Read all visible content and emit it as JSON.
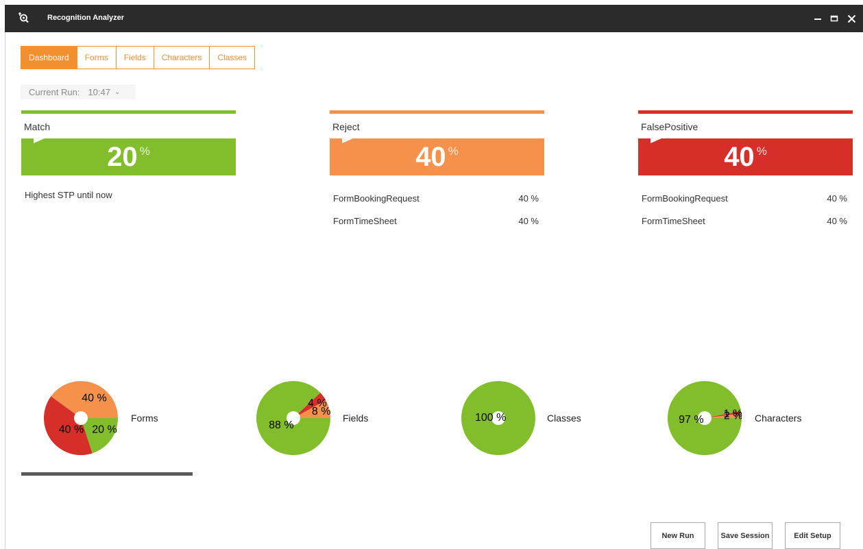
{
  "window": {
    "title": "Recognition Analyzer"
  },
  "tabs": [
    "Dashboard",
    "Forms",
    "Fields",
    "Characters",
    "Classes"
  ],
  "current_run": {
    "label": "Current Run:",
    "value": "10:47"
  },
  "cards": {
    "match": {
      "title": "Match",
      "value": "20",
      "unit": "%",
      "color": "#82be2c",
      "note": "Highest STP until now"
    },
    "reject": {
      "title": "Reject",
      "value": "40",
      "unit": "%",
      "color": "#f5914a",
      "rows": [
        {
          "name": "FormBookingRequest",
          "value": "40 %"
        },
        {
          "name": "FormTimeSheet",
          "value": "40 %"
        }
      ]
    },
    "falsepositive": {
      "title": "FalsePositive",
      "value": "40",
      "unit": "%",
      "color": "#d62e28",
      "rows": [
        {
          "name": "FormBookingRequest",
          "value": "40 %"
        },
        {
          "name": "FormTimeSheet",
          "value": "40 %"
        }
      ]
    }
  },
  "colors": {
    "match": "#82be2c",
    "reject": "#f5914a",
    "falsepositive": "#d62e28",
    "accent": "#f28f2e"
  },
  "charts": {
    "forms": {
      "label": "Forms",
      "slices": [
        {
          "name": "Match",
          "value": 20,
          "label": "20 %"
        },
        {
          "name": "Reject",
          "value": 40,
          "label": "40 %"
        },
        {
          "name": "FalsePositive",
          "value": 40,
          "label": "40 %"
        }
      ]
    },
    "fields": {
      "label": "Fields",
      "slices": [
        {
          "name": "Match",
          "value": 88,
          "label": "88 %"
        },
        {
          "name": "Reject",
          "value": 8,
          "label": "8 %"
        },
        {
          "name": "FalsePositive",
          "value": 4,
          "label": "4 %"
        }
      ]
    },
    "classes": {
      "label": "Classes",
      "slices": [
        {
          "name": "Match",
          "value": 100,
          "label": "100 %"
        }
      ]
    },
    "characters": {
      "label": "Characters",
      "slices": [
        {
          "name": "Match",
          "value": 97,
          "label": "97 %"
        },
        {
          "name": "Reject",
          "value": 2,
          "label": "2 %"
        },
        {
          "name": "FalsePositive",
          "value": 1,
          "label": "1 %"
        }
      ]
    }
  },
  "buttons": {
    "new_run": "New Run",
    "save_session": "Save Session",
    "edit_setup": "Edit Setup"
  }
}
